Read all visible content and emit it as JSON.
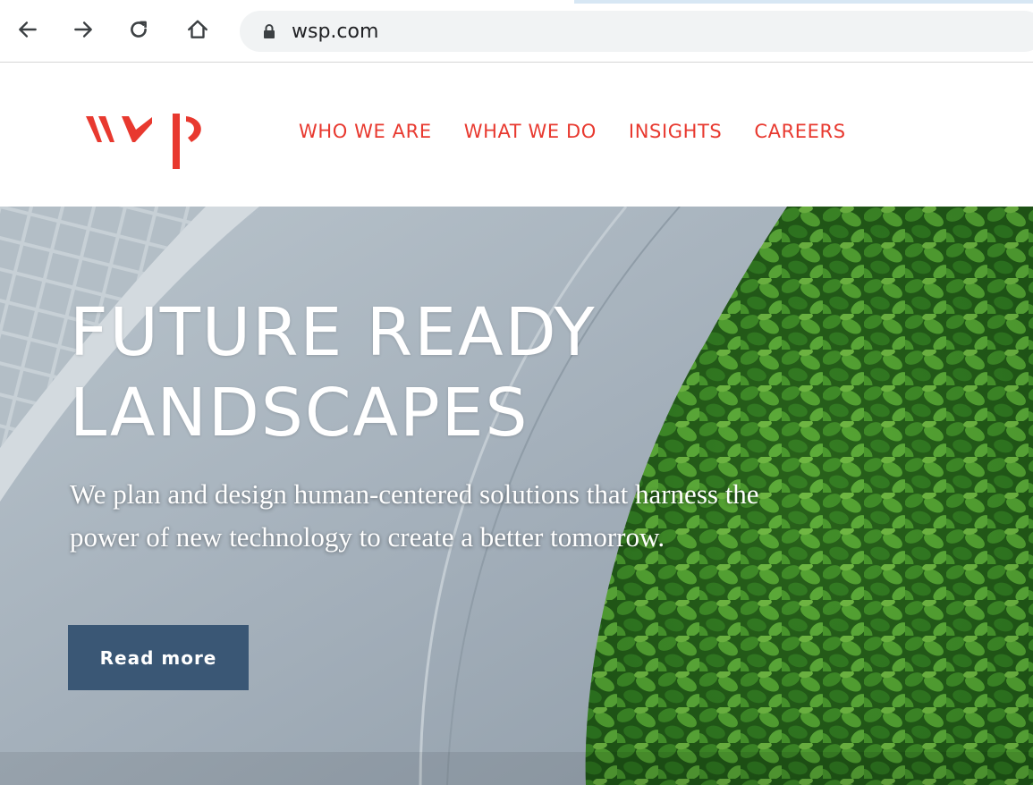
{
  "browser": {
    "url": "wsp.com",
    "icons": [
      "back-arrow-icon",
      "forward-arrow-icon",
      "reload-icon",
      "home-icon",
      "lock-icon"
    ]
  },
  "site": {
    "logo_text": "wsp",
    "brand_color": "#e8392f",
    "nav": [
      {
        "label": "WHO WE ARE"
      },
      {
        "label": "WHAT WE DO"
      },
      {
        "label": "INSIGHTS"
      },
      {
        "label": "CAREERS"
      }
    ]
  },
  "hero": {
    "title_line1": "FUTURE READY",
    "title_line2": "LANDSCAPES",
    "subtitle_line1": "We plan and design human-centered solutions that harness the",
    "subtitle_line2": "power of new technology to create a better tomorrow.",
    "button_label": "Read more",
    "button_color": "#3a5775"
  }
}
